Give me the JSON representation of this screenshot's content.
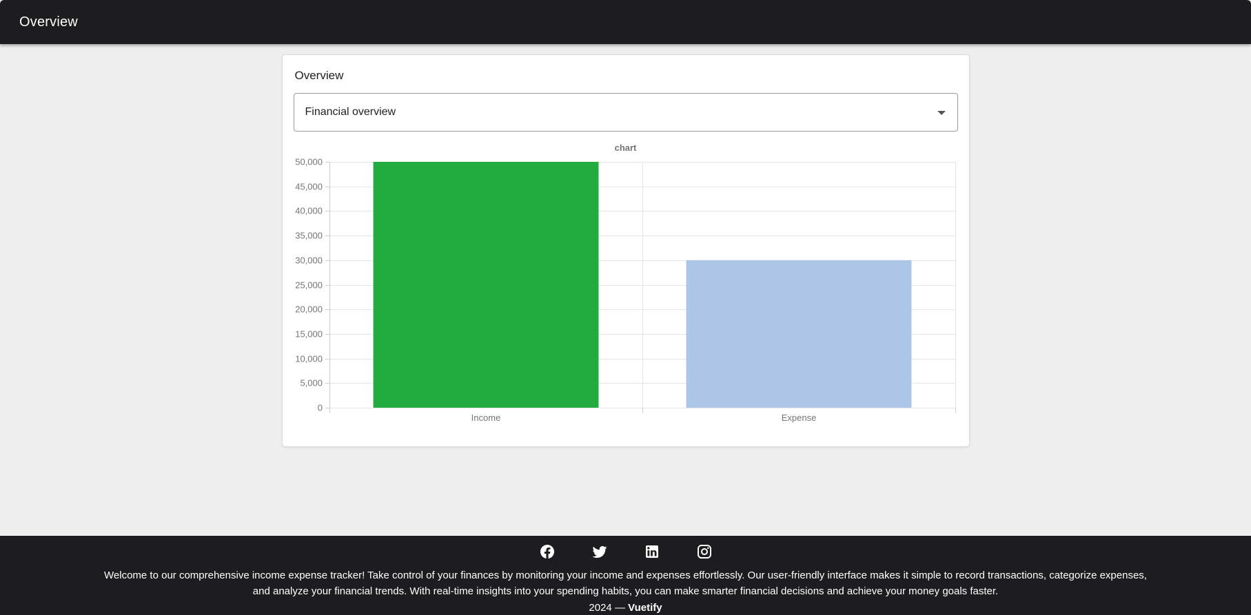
{
  "app_bar": {
    "title": "Overview"
  },
  "card": {
    "title": "Overview",
    "select": {
      "value": "Financial overview"
    }
  },
  "chart_data": {
    "type": "bar",
    "title": "chart",
    "categories": [
      "Income",
      "Expense"
    ],
    "values": [
      50000,
      30000
    ],
    "bar_colors": [
      "#21ac3d",
      "#adc6e8"
    ],
    "xlabel": "",
    "ylabel": "",
    "ylim": [
      0,
      50000
    ],
    "ytick_step": 5000,
    "ytick_labels": [
      "0",
      "5,000",
      "10,000",
      "15,000",
      "20,000",
      "25,000",
      "30,000",
      "35,000",
      "40,000",
      "45,000",
      "50,000"
    ],
    "grid": true,
    "legend": "none"
  },
  "footer": {
    "social_icons": [
      "facebook-icon",
      "twitter-icon",
      "linkedin-icon",
      "instagram-icon"
    ],
    "description": "Welcome to our comprehensive income expense tracker! Take control of your finances by monitoring your income and expenses effortlessly. Our user-friendly interface makes it simple to record transactions, categorize expenses, and analyze your financial trends. With real-time insights into your spending habits, you can make smarter financial decisions and achieve your money goals faster.",
    "copyright_year": "2024 —",
    "brand": "Vuetify"
  },
  "colors": {
    "app_bar_bg": "#1d1d1f",
    "footer_bg": "#1d1d1f",
    "page_bg": "#eeeeee",
    "income_bar": "#21ac3d",
    "expense_bar": "#adc6e8",
    "gridline": "#e6e6e6",
    "axis": "#cccccc",
    "chart_label": "#757575"
  }
}
